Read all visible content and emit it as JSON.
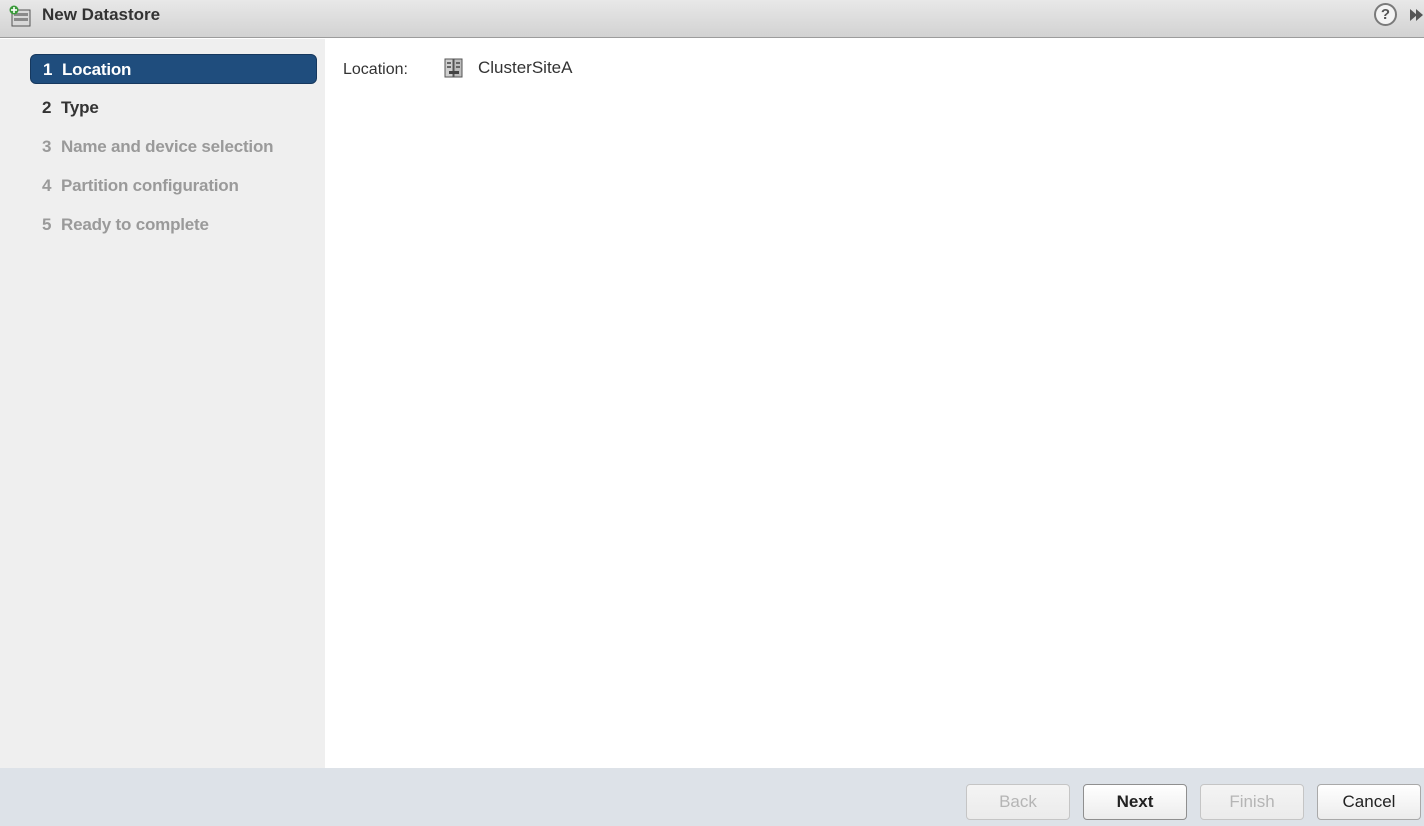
{
  "window": {
    "title": "New Datastore",
    "title_icon": "new-datastore-icon",
    "help_glyph": "?"
  },
  "steps": [
    {
      "number": "1",
      "label": "Location",
      "state": "active"
    },
    {
      "number": "2",
      "label": "Type",
      "state": "enabled"
    },
    {
      "number": "3",
      "label": "Name and device selection",
      "state": "disabled"
    },
    {
      "number": "4",
      "label": "Partition configuration",
      "state": "disabled"
    },
    {
      "number": "5",
      "label": "Ready to complete",
      "state": "disabled"
    }
  ],
  "location": {
    "label": "Location:",
    "value": "ClusterSiteA",
    "icon": "cluster-icon"
  },
  "footer": {
    "back_label": "Back",
    "next_label": "Next",
    "finish_label": "Finish",
    "cancel_label": "Cancel"
  },
  "colors": {
    "active_step_bg": "#1f4d7d",
    "sidebar_bg": "#efefef",
    "footer_bg": "#dde2e8"
  }
}
